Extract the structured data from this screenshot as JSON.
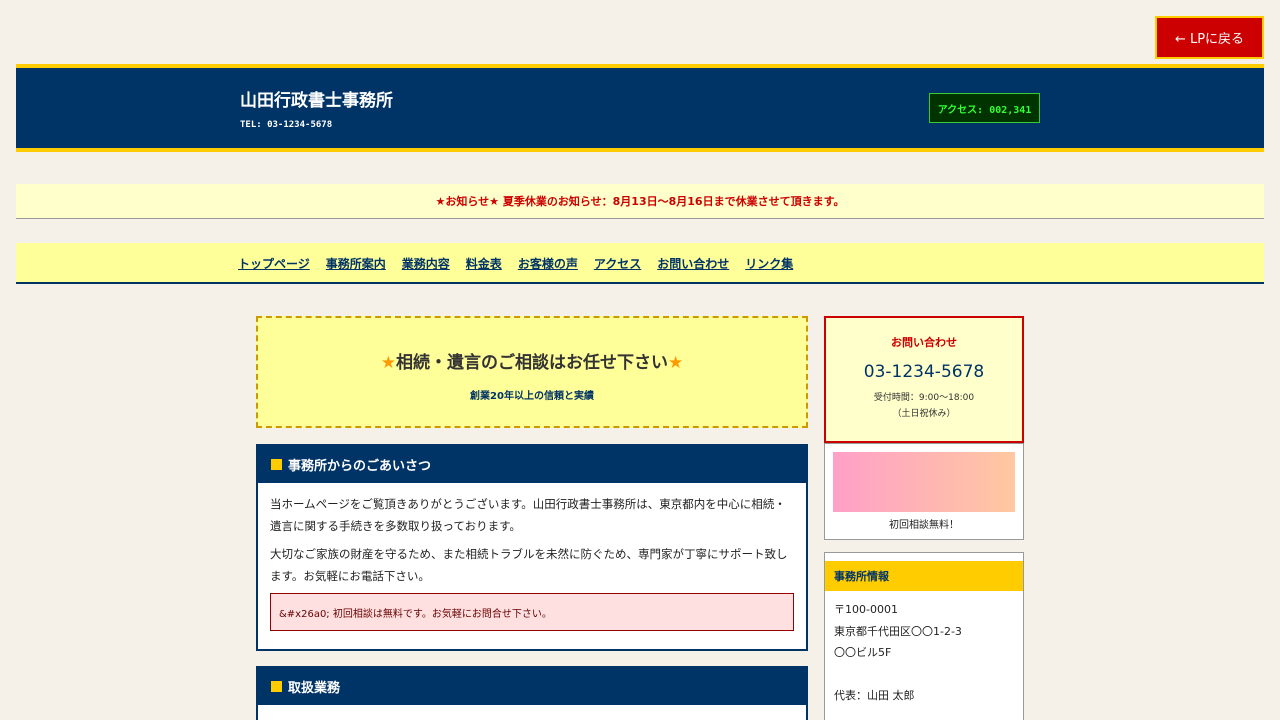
{
  "lp_button": {
    "label": "← LPに戻る"
  },
  "header": {
    "title": "山田行政書士事務所",
    "tel": "TEL: 03-1234-5678",
    "counter": "アクセス: 002,341"
  },
  "notice": {
    "text": "★お知らせ★ 夏季休業のお知らせ：8月13日～8月16日まで休業させて頂きます。"
  },
  "nav": {
    "items": [
      {
        "label": "トップページ"
      },
      {
        "label": "事務所案内"
      },
      {
        "label": "業務内容"
      },
      {
        "label": "料金表"
      },
      {
        "label": "お客様の声"
      },
      {
        "label": "アクセス"
      },
      {
        "label": "お問い合わせ"
      },
      {
        "label": "リンク集"
      }
    ]
  },
  "hero": {
    "star": "★",
    "title": "相続・遺言のご相談はお任せ下さい",
    "subtitle": "創業20年以上の信頼と実績"
  },
  "greeting": {
    "heading": "事務所からのごあいさつ",
    "para1": "当ホームページをご覧頂きありがとうございます。山田行政書士事務所は、東京都内を中心に相続・遺言に関する手続きを多数取り扱っております。",
    "para2": "大切なご家族の財産を守るため、また相続トラブルを未然に防ぐため、専門家が丁寧にサポート致します。お気軽にお電話下さい。",
    "alert": "&#x26a0; 初回相談は無料です。お気軽にお問合せ下さい。"
  },
  "services": {
    "heading": "取扱業務"
  },
  "sidebar": {
    "contact": {
      "title": "お問い合わせ",
      "tel": "03-1234-5678",
      "hours": "受付時間：9:00〜18:00",
      "closed": "（土日祝休み）"
    },
    "banner": {
      "caption": "初回相談無料！"
    },
    "info": {
      "heading": "事務所情報",
      "postal": "〒100-0001",
      "address1": "東京都千代田区〇〇1-2-3",
      "address2": "〇〇ビル5F",
      "rep": "代表：山田 太郎"
    }
  },
  "colors": {
    "header_bg": "#003366",
    "accent_yellow": "#ffcc00",
    "alert_red": "#cc0000"
  }
}
